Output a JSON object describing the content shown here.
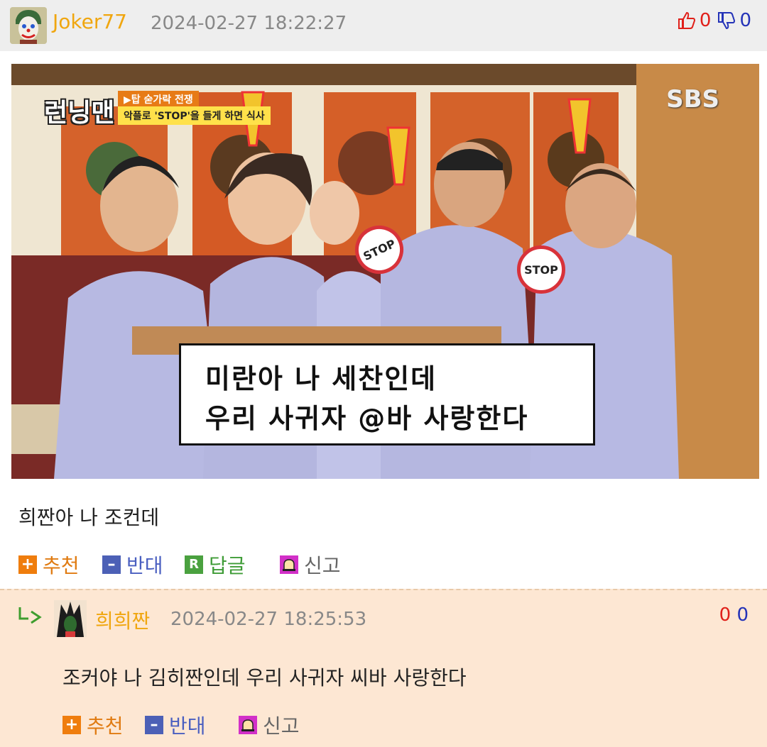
{
  "main_comment": {
    "username": "Joker77",
    "timestamp": "2024-02-27 18:22:27",
    "upvotes": "0",
    "downvotes": "0",
    "image": {
      "show_logo": "런닝맨",
      "banner_top": "▶탑 숟가락 전쟁",
      "banner_bottom": "악플로 'STOP'을 들게 하면 식사",
      "broadcaster": "SBS",
      "sign_text": "STOP",
      "subtitle_line1": "미란아 나 세찬인데",
      "subtitle_line2": "우리 사귀자 @바 사랑한다"
    },
    "text": "희짠아 나 조컨데",
    "actions": {
      "recommend": "추천",
      "oppose": "반대",
      "reply": "답글",
      "report": "신고",
      "reply_icon_letter": "R"
    }
  },
  "reply_comment": {
    "username": "희희짠",
    "timestamp": "2024-02-27 18:25:53",
    "upvotes": "0",
    "downvotes": "0",
    "text": "조커야 나 김히짠인데 우리 사귀자 씨바 사랑한다",
    "actions": {
      "recommend": "추천",
      "oppose": "반대",
      "report": "신고"
    }
  },
  "colors": {
    "username": "#f0a60f",
    "upvote": "#e0201a",
    "downvote": "#2433b8",
    "reply_background": "#fde7d3"
  }
}
